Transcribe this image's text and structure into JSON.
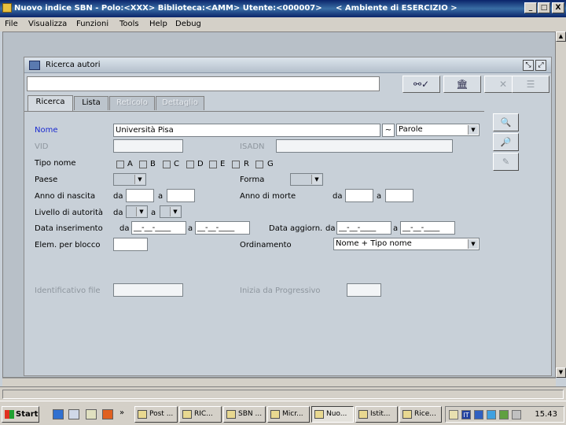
{
  "window": {
    "title": "Nuovo indice SBN - Polo:<XXX> Biblioteca:<AMM> Utente:<000007>     < Ambiente di ESERCIZIO >",
    "minimize": "_",
    "maximize": "□",
    "close": "X"
  },
  "menu": [
    "File",
    "Visualizza",
    "Funzioni",
    "Tools",
    "Help",
    "Debug"
  ],
  "scroll": {
    "up": "▲",
    "down": "▼"
  },
  "inner": {
    "title": "Ricerca autori",
    "icon_min": "⤡",
    "icon_max": "⤢",
    "toolbar_icons": [
      "binoculars-check-icon",
      "building-icon",
      "close-x-icon",
      "list-icon"
    ]
  },
  "tabs": [
    {
      "label": "Ricerca",
      "state": "selected"
    },
    {
      "label": "Lista",
      "state": "enabled"
    },
    {
      "label": "Reticolo",
      "state": "disabled"
    },
    {
      "label": "Dettaglio",
      "state": "disabled"
    }
  ],
  "form": {
    "nome": {
      "label": "Nome",
      "value": "Università Pisa",
      "op": "~",
      "match": "Parole"
    },
    "vid": {
      "label": "VID",
      "value": ""
    },
    "isadn": {
      "label": "ISADN",
      "value": ""
    },
    "tipo_nome": {
      "label": "Tipo nome",
      "options": [
        "A",
        "B",
        "C",
        "D",
        "E",
        "R",
        "G"
      ]
    },
    "paese": {
      "label": "Paese",
      "value": ""
    },
    "forma": {
      "label": "Forma",
      "value": ""
    },
    "anno_nascita": {
      "label": "Anno di nascita",
      "da": "da",
      "a": "a"
    },
    "anno_morte": {
      "label": "Anno di morte",
      "da": "da",
      "a": "a"
    },
    "livello": {
      "label": "Livello di autorità",
      "da": "da",
      "a": "a"
    },
    "data_ins": {
      "label": "Data inserimento",
      "da": "da",
      "a": "a",
      "from": "__-__-____",
      "to": "__-__-____"
    },
    "data_agg": {
      "label": "Data aggiorn.",
      "da": "da",
      "a": "a",
      "from": "__-__-____",
      "to": "__-__-____"
    },
    "elem": {
      "label": "Elem. per blocco",
      "value": ""
    },
    "ordinamento": {
      "label": "Ordinamento",
      "value": "Nome + Tipo nome"
    },
    "identificativo": {
      "label": "Identificativo file",
      "value": ""
    },
    "inizia": {
      "label": "Inizia da Progressivo",
      "value": ""
    }
  },
  "side_buttons": [
    "search-icon",
    "search-refine-icon",
    "edit-icon"
  ],
  "taskbar": {
    "start": "Start",
    "more": "»",
    "tasks": [
      {
        "label": "Post ..."
      },
      {
        "label": "RIC..."
      },
      {
        "label": "SBN ..."
      },
      {
        "label": "Micr..."
      },
      {
        "label": "Nuo...",
        "active": true
      },
      {
        "label": "Istit..."
      },
      {
        "label": "Rice..."
      }
    ],
    "lang": "IT",
    "clock": "15.43"
  }
}
